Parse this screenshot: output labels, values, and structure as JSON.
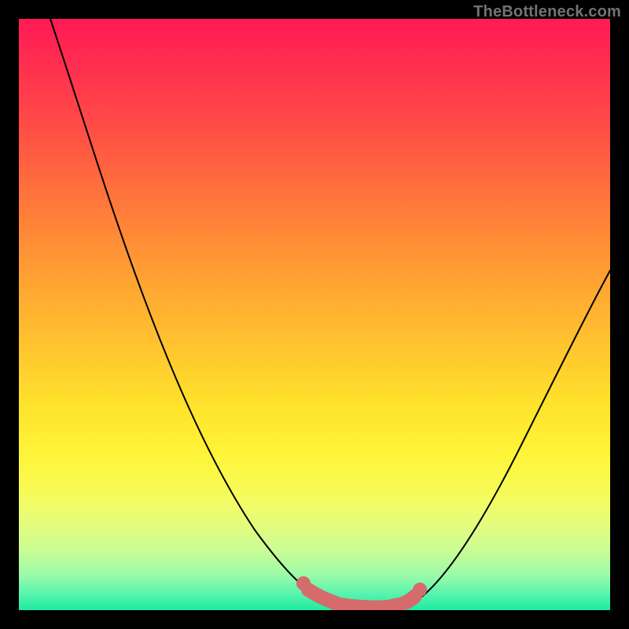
{
  "watermark": "TheBottleneck.com",
  "colors": {
    "page_bg": "#000000",
    "watermark": "#737373",
    "curve": "#000000",
    "highlight": "#d56b6b",
    "gradient_stops": [
      "#ff1a56",
      "#ff2f4f",
      "#ff5244",
      "#ff7b3a",
      "#ffa233",
      "#ffc62e",
      "#ffe42c",
      "#fff53a",
      "#f7fb58",
      "#e8fc7a",
      "#c9fd95",
      "#9cfba8",
      "#5df4af",
      "#1deca0"
    ]
  },
  "chart_data": {
    "type": "line",
    "title": "",
    "xlabel": "",
    "ylabel": "",
    "xlim": [
      0,
      100
    ],
    "ylim": [
      0,
      100
    ],
    "grid": false,
    "legend": false,
    "series": [
      {
        "name": "bottleneck-curve",
        "x": [
          5,
          10,
          15,
          20,
          25,
          30,
          35,
          40,
          45,
          48,
          50,
          52,
          55,
          57,
          60,
          62,
          65,
          70,
          75,
          80,
          85,
          90,
          95,
          100
        ],
        "y": [
          100,
          87,
          74,
          62,
          51,
          41,
          32,
          24,
          16,
          10,
          6,
          3,
          1,
          0,
          0,
          0,
          1,
          5,
          12,
          21,
          31,
          41,
          50,
          58
        ]
      }
    ],
    "annotations": [
      {
        "name": "optimal-range-highlight",
        "x_range": [
          48,
          65
        ],
        "y_at_range": [
          10,
          1
        ],
        "note": "pink markers along valley floor"
      }
    ]
  }
}
